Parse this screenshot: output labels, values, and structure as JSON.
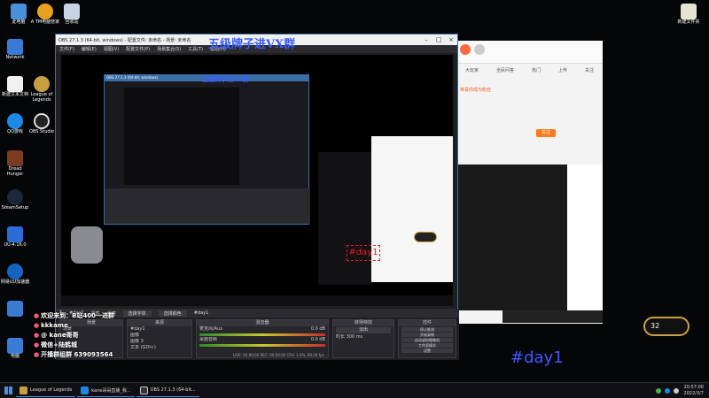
{
  "desktop": {
    "icons": [
      {
        "label": "此电脑"
      },
      {
        "label": "A TM电脑管家"
      },
      {
        "label": "回收站"
      },
      {
        "label": "Network"
      },
      {
        "label": "新建文本文档"
      },
      {
        "label": "League of Legends"
      },
      {
        "label": "QQ游戏"
      },
      {
        "label": "OBS Studio"
      },
      {
        "label": "Dread Hunger"
      },
      {
        "label": "SteamSetup"
      },
      {
        "label": "UU-4.16.0"
      },
      {
        "label": "网易UU加速器"
      },
      {
        "label": "电脑"
      },
      {
        "label": "新建文件夹"
      }
    ]
  },
  "obs": {
    "title": "OBS 27.1.3 (64-bit, windows) - 配置文件: 未命名 - 场景: 未命名",
    "menu": [
      "文件(F)",
      "编辑(E)",
      "视图(V)",
      "配置文件(P)",
      "场景集合(S)",
      "工具(T)",
      "帮助(H)"
    ],
    "watermark": "五级牌子进VX群",
    "nested_title": "OBS 27.1.3 (64-bit, windows)",
    "day_label": "#day1",
    "source_bar": {
      "label": "#day1",
      "props": "属性",
      "filters": "滤镜",
      "select_font": "选择字体",
      "select_color": "选择颜色",
      "text_value": "#day1"
    },
    "docks": {
      "scenes": {
        "header": "场景",
        "items": [
          "场景",
          "场景 2"
        ]
      },
      "sources": {
        "header": "来源",
        "items": [
          "#day1",
          "图像",
          "图像 3",
          "文本 (GDI+)",
          "显示器采集"
        ]
      },
      "mixer": {
        "header": "混音器",
        "tracks": [
          {
            "name": "麦克风/Aux",
            "db": "0.0 dB"
          },
          {
            "name": "桌面音频",
            "db": "0.0 dB"
          }
        ]
      },
      "transitions": {
        "header": "转场特效",
        "type": "淡出",
        "duration_label": "时长",
        "duration": "300 ms"
      },
      "controls": {
        "header": "控件",
        "buttons": [
          "停止推流",
          "开始录制",
          "启动虚拟摄像机",
          "工作室模式",
          "设置",
          "退出"
        ]
      }
    },
    "status": "LIVE: 00:00:00   REC: 00:00:00   CPU: 1.0%, 60.00 fps"
  },
  "overlay": {
    "lines": [
      "欢迎来到：B站400一进群",
      "kkkame",
      "@ kane哥哥",
      "微信+陆鹤城",
      "开播群组群 639093564"
    ]
  },
  "stream_watermark": "#day1",
  "right_panel": {
    "top_tabs": [
      "大玩家",
      "全民问答",
      "热门",
      "上传",
      "关注"
    ],
    "notice": "恭喜你成为粉丝",
    "live_btn": "关注",
    "counter": "32"
  },
  "taskbar": {
    "items": [
      {
        "label": "League of Legends"
      },
      {
        "label": "kane哥哥直播_我..."
      },
      {
        "label": "OBS 27.1.3 (64-bit..."
      }
    ],
    "clock_time": "20:57:00",
    "clock_date": "2022/3/7"
  },
  "colors": {
    "accent": "#3a6ea5",
    "obs_bg": "#1f1f23",
    "watermark": "#3a5cff",
    "day_red": "#e11d2a",
    "day_blue": "#3b5bff"
  }
}
